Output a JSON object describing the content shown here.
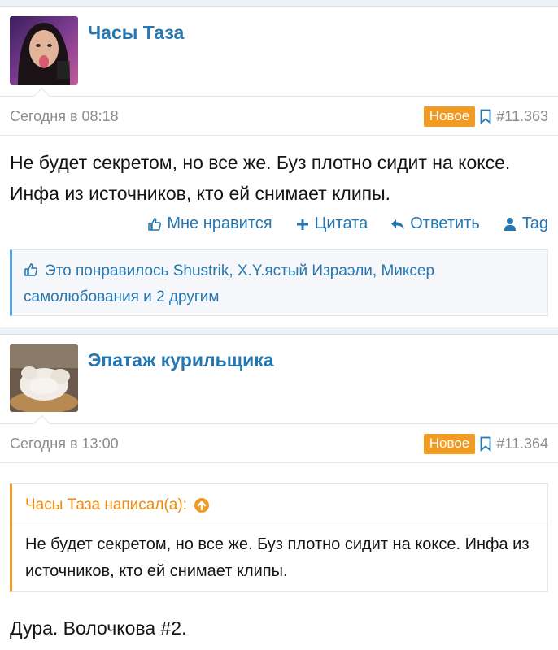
{
  "posts": [
    {
      "username": "Часы Таза",
      "avatar": "woman-avatar",
      "date": "Сегодня в 08:18",
      "badge": "Новое",
      "number": "#11.363",
      "text": "Не будет секретом, но все же. Буз плотно сидит на коксе. Инфа из источников, кто ей снимает клипы.",
      "actions": [
        "Мне нравится",
        "Цитата",
        "Ответить",
        "Tag"
      ],
      "likes": "Это понравилось Shustrik, X.Y.ястый Израэли, Миксер самолюбования и 2 другим"
    },
    {
      "username": "Эпатаж курильщика",
      "avatar": "chicken-avatar",
      "date": "Сегодня в 13:00",
      "badge": "Новое",
      "number": "#11.364",
      "quote": {
        "author": "Часы Таза написал(а):",
        "text": "Не будет секретом, но все же. Буз плотно сидит на коксе. Инфа из источников, кто ей снимает клипы."
      },
      "text": "Дура. Волочкова #2."
    }
  ],
  "colors": {
    "link": "#2577b1",
    "badge": "#f29b22",
    "quote_accent": "#f29b22",
    "likes_accent": "#52a0dc"
  }
}
